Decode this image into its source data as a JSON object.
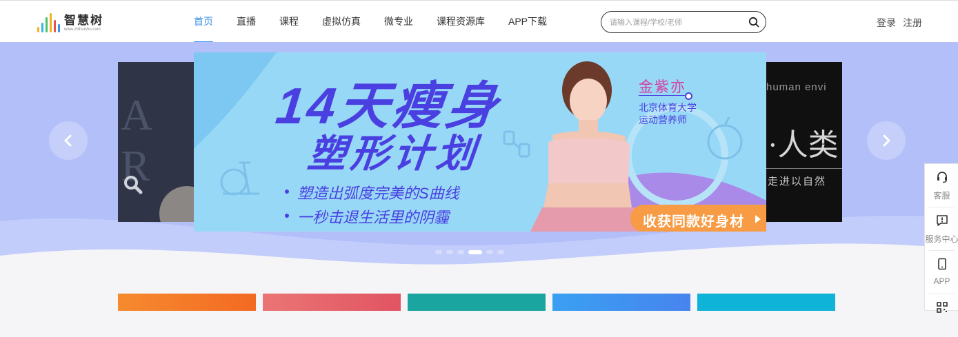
{
  "brand": {
    "name": "智慧树",
    "url": "www.zhihuishu.com"
  },
  "nav": [
    {
      "label": "首页",
      "active": true
    },
    {
      "label": "直播"
    },
    {
      "label": "课程"
    },
    {
      "label": "虚拟仿真"
    },
    {
      "label": "微专业"
    },
    {
      "label": "课程资源库"
    },
    {
      "label": "APP下载"
    }
  ],
  "search": {
    "placeholder": "请输入课程/学校/老师",
    "icon": "search-icon"
  },
  "auth": {
    "login": "登录",
    "register": "注册"
  },
  "banner": {
    "title_line1": "14天瘦身",
    "title_line2": "塑形计划",
    "bullets": [
      "塑造出弧度完美的S曲线",
      "一秒击退生活里的阴霾"
    ],
    "coach_name": "金紫亦",
    "coach_school": "北京体育大学",
    "coach_title": "运动营养师",
    "cta": "收获同款好身材",
    "colors": {
      "background": "#98d8f7",
      "title": "#4a3fe0",
      "cta": "#f79b45",
      "accent": "#d43fa0"
    }
  },
  "side_left": {
    "text": "A R"
  },
  "side_right": {
    "line1": "human envi",
    "line2": "·人类",
    "line3": "走进以自然"
  },
  "carousel": {
    "total": 6,
    "active_index": 3
  },
  "categories": [
    {
      "color": "#f67a2b"
    },
    {
      "color": "#e4636b"
    },
    {
      "color": "#1aa5a0"
    },
    {
      "color": "#3f8df0"
    },
    {
      "color": "#10b3d8"
    }
  ],
  "toolbar": [
    {
      "label": "客服",
      "icon": "headset-icon"
    },
    {
      "label": "服务中心",
      "icon": "service-center-icon"
    },
    {
      "label": "APP",
      "icon": "phone-icon"
    },
    {
      "label": "",
      "icon": "qrcode-icon"
    }
  ]
}
